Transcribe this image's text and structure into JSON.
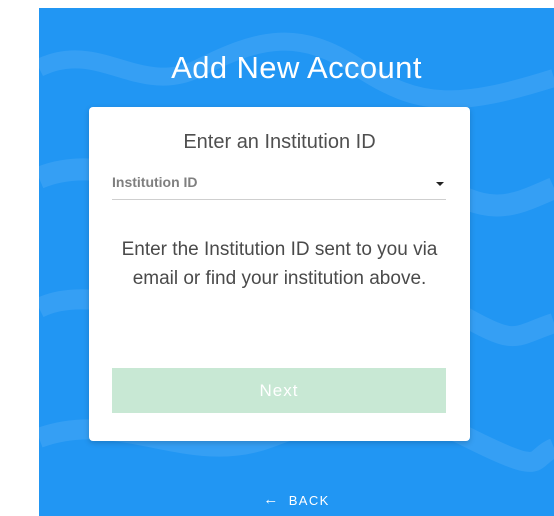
{
  "page": {
    "title": "Add New Account"
  },
  "card": {
    "heading": "Enter an Institution ID",
    "select_value": "Institution ID",
    "help_text": "Enter the Institution ID sent to you via email or find your institution above.",
    "next_label": "Next"
  },
  "footer": {
    "back_label": "BACK"
  },
  "icons": {
    "back": "left-arrow-icon",
    "dropdown": "chevron-down-icon"
  },
  "colors": {
    "background": "#2196f3",
    "card": "#ffffff",
    "button": "#c8e8d4"
  }
}
